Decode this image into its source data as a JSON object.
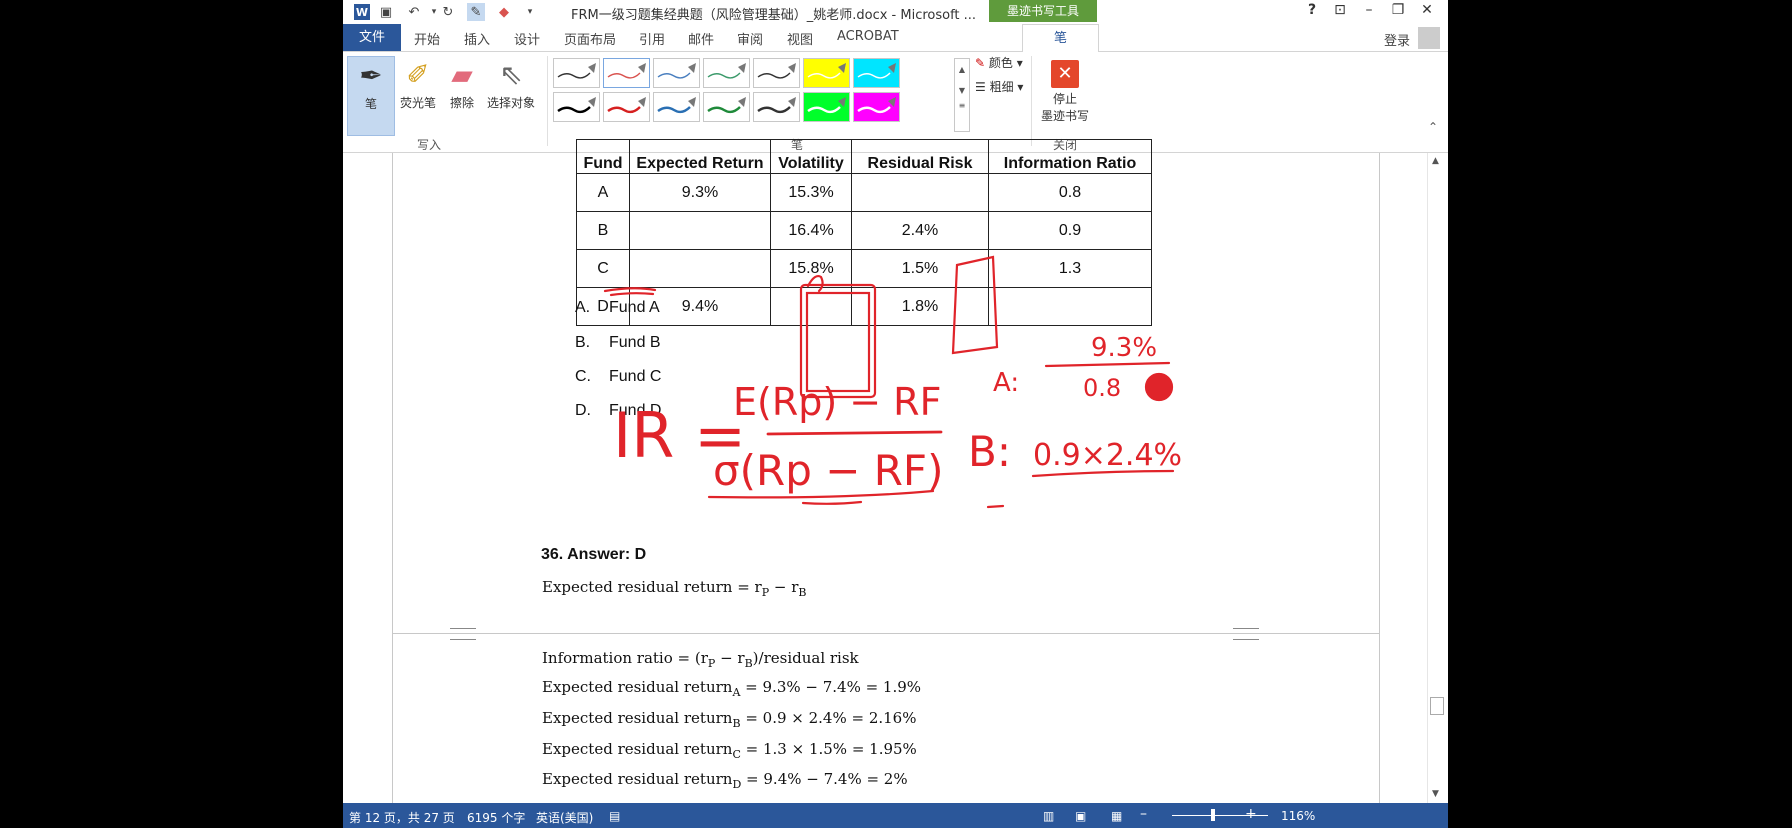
{
  "titlebar": {
    "doc_title": "FRM一级习题集经典题（风险管理基础）_姚老师.docx - Microsoft ...",
    "context_tab": "墨迹书写工具",
    "help": "?",
    "word_icon": "W"
  },
  "tabs": {
    "file": "文件",
    "items": [
      "开始",
      "插入",
      "设计",
      "页面布局",
      "引用",
      "邮件",
      "审阅",
      "视图",
      "ACROBAT"
    ],
    "active": "笔",
    "login": "登录"
  },
  "ribbon": {
    "pen": "笔",
    "highlighter": "荧光笔",
    "eraser": "擦除",
    "select": "选择对象",
    "write_group": "写入",
    "pens_group": "笔",
    "color": "颜色",
    "thickness": "粗细",
    "stop_line1": "停止",
    "stop_line2": "墨迹书写",
    "close_group": "关闭",
    "pen_colors_row1": [
      "#333333",
      "#d9534f",
      "#4a7fbf",
      "#3c9a6b",
      "#333333",
      "#ffff00",
      "#00e5ff"
    ],
    "pen_colors_row2": [
      "#000000",
      "#d62020",
      "#2a6fb3",
      "#1f8a3a",
      "#333333",
      "#00ff2a",
      "#ff00ff"
    ]
  },
  "table": {
    "headers": [
      "Fund",
      "Expected Return",
      "Volatility",
      "Residual Risk",
      "Information Ratio"
    ],
    "rows": [
      [
        "A",
        "9.3%",
        "15.3%",
        "",
        "0.8"
      ],
      [
        "B",
        "",
        "16.4%",
        "2.4%",
        "0.9"
      ],
      [
        "C",
        "",
        "15.8%",
        "1.5%",
        "1.3"
      ],
      [
        "D",
        "9.4%",
        "",
        "1.8%",
        ""
      ]
    ]
  },
  "options": [
    {
      "letter": "A.",
      "text": "Fund A"
    },
    {
      "letter": "B.",
      "text": "Fund B"
    },
    {
      "letter": "C.",
      "text": "Fund C"
    },
    {
      "letter": "D.",
      "text": "Fund D"
    }
  ],
  "answer": "36.  Answer: D",
  "formulas": {
    "residual_return": "Expected residual return = r",
    "info_ratio": "Information ratio = (r",
    "ra_pre": "Expected residual return",
    "ra_val": " = 9.3% − 7.4% = 1.9%",
    "rb_val": " = 0.9 × 2.4%  = 2.16%",
    "rc_val": " = 1.3 × 1.5% = 1.95%",
    "rd_val": " = 9.4% − 7.4% = 2%"
  },
  "ink_notes": {
    "ir": "IR =",
    "numerator": "E(Rp) − RF",
    "denominator": "σ(Rp − RF)",
    "a_label": "A:",
    "a_num": "9.3%",
    "a_den": "0.8",
    "b_label": "B:",
    "b_expr": "0.9×2.4%"
  },
  "status": {
    "page": "第 12 页，共 27 页",
    "words": "6195 个字",
    "language": "英语(美国)",
    "zoom": "116%"
  }
}
